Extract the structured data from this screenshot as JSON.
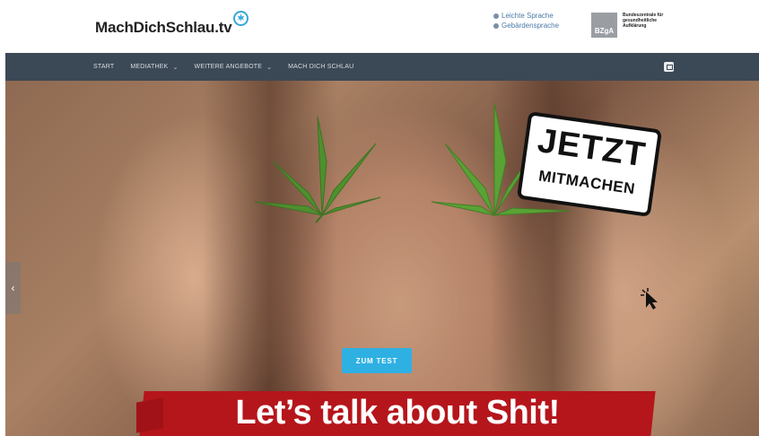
{
  "header": {
    "logo_text": "MachDichSchlau.tv",
    "accessibility_links": [
      {
        "label": "Leichte Sprache",
        "icon": "easy-language-icon"
      },
      {
        "label": "Gebärdensprache",
        "icon": "sign-language-icon"
      }
    ],
    "partner_logo": {
      "abbr": "BZgA",
      "name": "Bundeszentrale für gesundheitliche Aufklärung"
    }
  },
  "nav": {
    "items": [
      {
        "label": "START",
        "dropdown": false
      },
      {
        "label": "MEDIATHEK",
        "dropdown": true
      },
      {
        "label": "WEITERE ANGEBOTE",
        "dropdown": true
      },
      {
        "label": "MACH DICH SCHLAU",
        "dropdown": false
      }
    ],
    "action_icon": "instagram-icon"
  },
  "hero": {
    "badge_line1": "JETZT",
    "badge_line2": "MITMACHEN",
    "cta_label": "ZUM TEST",
    "banner_text": "Let’s talk about Shit!",
    "slider_prev": "‹"
  },
  "colors": {
    "nav_bg": "#3b4856",
    "cta": "#2fb0e3",
    "banner_red": "#b5161b",
    "logo_accent": "#37a8d8"
  }
}
